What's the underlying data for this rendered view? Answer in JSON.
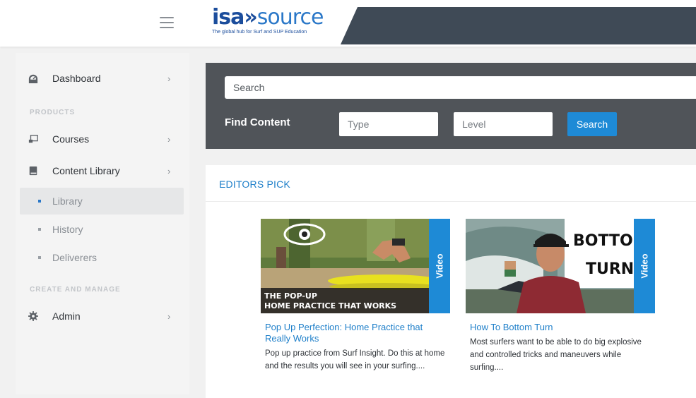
{
  "header": {
    "logo_main": "isa",
    "logo_arrows": "»",
    "logo_source": "source",
    "logo_tagline": "The global hub for Surf and SUP Education"
  },
  "sidebar": {
    "dashboard": "Dashboard",
    "products_title": "PRODUCTS",
    "courses": "Courses",
    "content_library": "Content Library",
    "sub_items": [
      "Library",
      "History",
      "Deliverers"
    ],
    "create_title": "CREATE AND MANAGE",
    "admin": "Admin",
    "chevron": "›"
  },
  "search": {
    "placeholder": "Search",
    "find_label": "Find Content",
    "type_placeholder": "Type",
    "level_placeholder": "Level",
    "button": "Search"
  },
  "editors_pick": {
    "title": "EDITORS PICK",
    "cards": [
      {
        "tag": "Video",
        "overlay_line1": "THE POP-UP",
        "overlay_line2": "HOME PRACTICE THAT WORKS",
        "title": "Pop Up Perfection: Home Practice that Really Works",
        "description": "Pop up practice from Surf Insight. Do this at home and the results you will see in your surfing...."
      },
      {
        "tag": "Video",
        "overlay_line1": "BOTTO",
        "overlay_line2": "TURN",
        "title": "How To Bottom Turn",
        "description": "Most surfers want to be able to do big explosive and controlled tricks and maneuvers while surfing...."
      }
    ]
  },
  "colors": {
    "accent": "#1e8ad6",
    "link": "#1e7fc9",
    "panel_dark": "#505459",
    "header_dark": "#3f4a56"
  }
}
